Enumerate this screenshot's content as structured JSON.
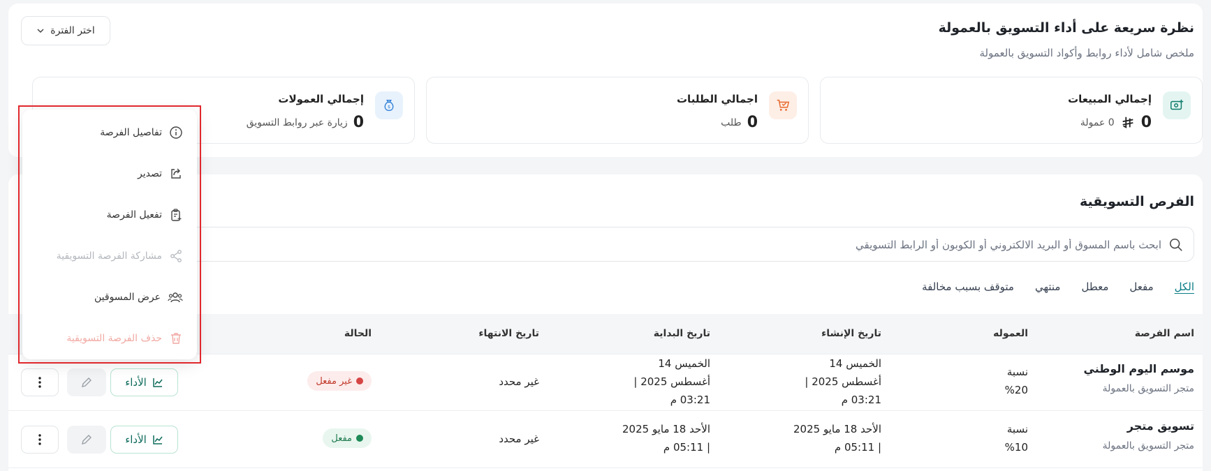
{
  "overview": {
    "title": "نظرة سريعة على أداء التسويق بالعمولة",
    "subtitle": "ملخص شامل لأداء روابط وأكواد التسويق بالعمولة",
    "period_label": "اختر الفترة",
    "stats": [
      {
        "label": "إجمالي المبيعات",
        "value": "0",
        "unit": "0 عمولة",
        "icon": "money-icon",
        "currency_icon": "riyal-icon"
      },
      {
        "label": "اجمالي الطلبات",
        "value": "0",
        "unit": "طلب",
        "icon": "cart-icon"
      },
      {
        "label": "إجمالي العمولات",
        "value": "0",
        "unit": "زيارة عبر روابط التسويق",
        "icon": "money-bag-icon"
      }
    ]
  },
  "opportunities": {
    "title": "الفرص التسويقية",
    "search_placeholder": "ابحث باسم المسوق أو البريد الالكتروني أو الكوبون أو الرابط التسويقي",
    "tabs": [
      "الكل",
      "مفعل",
      "معطل",
      "منتهي",
      "متوقف بسبب مخالفة"
    ],
    "active_tab": "الكل",
    "columns": {
      "name": "اسم الفرصة",
      "commission": "العموله",
      "created": "تاريخ الإنشاء",
      "start": "تاريخ البداية",
      "end": "تاريخ الانتهاء",
      "status": "الحالة"
    },
    "rows": [
      {
        "name": "موسم اليوم الوطني",
        "store": "متجر التسويق بالعمولة",
        "commission_1": "نسبة",
        "commission_2": "%20",
        "created_1": "الخميس 14",
        "created_2": "أغسطس 2025 |",
        "created_3": "03:21 م",
        "start_1": "الخميس 14",
        "start_2": "أغسطس 2025 |",
        "start_3": "03:21 م",
        "end": "غير محدد",
        "status": "غير مفعل",
        "perf_label": "الأداء"
      },
      {
        "name": "تسويق متجر",
        "store": "متجر التسويق بالعمولة",
        "commission_1": "نسبة",
        "commission_2": "%10",
        "created_1": "الأحد 18 مايو 2025",
        "created_2": "| 05:11 م",
        "start_1": "الأحد 18 مايو 2025",
        "start_2": "| 05:11 م",
        "end": "غير محدد",
        "status": "مفعل",
        "perf_label": "الأداء"
      }
    ]
  },
  "menu": {
    "items": [
      {
        "label": "تفاصيل الفرصة",
        "icon": "info-icon"
      },
      {
        "label": "تصدير",
        "icon": "share-export-icon"
      },
      {
        "label": "تفعيل الفرصة",
        "icon": "clipboard-plus-icon"
      },
      {
        "label": "مشاركة الفرصة التسويقية",
        "icon": "share-nodes-icon"
      },
      {
        "label": "عرض المسوقين",
        "icon": "users-icon"
      },
      {
        "label": "حذف الفرصة التسويقية",
        "icon": "trash-icon"
      }
    ]
  },
  "colors": {
    "accent": "#0a7c86",
    "highlight": "#e0282e"
  }
}
